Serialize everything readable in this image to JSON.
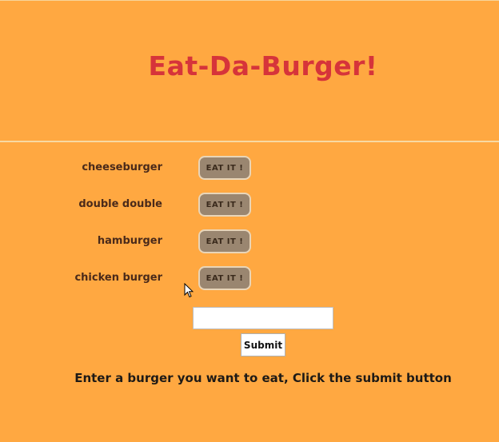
{
  "header": {
    "title": "Eat-Da-Burger!"
  },
  "burgers": [
    {
      "name": "cheeseburger",
      "button_label": "EAT IT !"
    },
    {
      "name": "double double",
      "button_label": "EAT IT !"
    },
    {
      "name": "hamburger",
      "button_label": "EAT IT !"
    },
    {
      "name": "chicken burger",
      "button_label": "EAT IT !"
    }
  ],
  "form": {
    "input_value": "",
    "input_placeholder": "",
    "submit_label": "Submit",
    "instructions": "Enter a burger you want to eat, Click the submit button"
  },
  "colors": {
    "background": "#FFA841",
    "title": "#D6343A",
    "eat_button": "#9A8670"
  },
  "icons": {
    "cursor": "mouse-pointer-icon"
  }
}
